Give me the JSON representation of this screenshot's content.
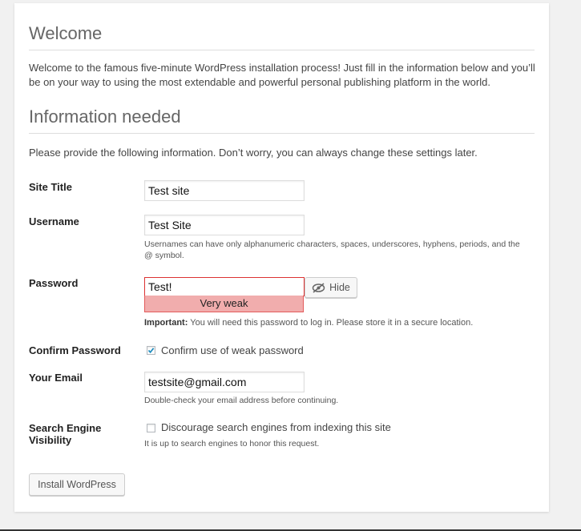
{
  "welcome": {
    "heading": "Welcome",
    "intro": "Welcome to the famous five-minute WordPress installation process! Just fill in the information below and you’ll be on your way to using the most extendable and powerful personal publishing platform in the world."
  },
  "info": {
    "heading": "Information needed",
    "prompt": "Please provide the following information. Don’t worry, you can always change these settings later."
  },
  "form": {
    "site_title": {
      "label": "Site Title",
      "value": "Test site"
    },
    "username": {
      "label": "Username",
      "value": "Test Site",
      "description": "Usernames can have only alphanumeric characters, spaces, underscores, hyphens, periods, and the @ symbol."
    },
    "password": {
      "label": "Password",
      "value": "Test!",
      "strength": "Very weak",
      "hide_button": "Hide",
      "note_strong": "Important:",
      "note": " You will need this password to log in. Please store it in a secure location."
    },
    "confirm_password": {
      "label": "Confirm Password",
      "checkbox_label": "Confirm use of weak password",
      "checked": true
    },
    "email": {
      "label": "Your Email",
      "value": "testsite@gmail.com",
      "description": "Double-check your email address before continuing."
    },
    "search_visibility": {
      "label_line1": "Search Engine",
      "label_line2": "Visibility",
      "checkbox_label": "Discourage search engines from indexing this site",
      "checked": false,
      "description": "It is up to search engines to honor this request."
    },
    "submit_label": "Install WordPress"
  },
  "colors": {
    "strength_bg": "#f1adad",
    "error_border": "#dc3232",
    "page_bg": "#f1f1f1"
  }
}
